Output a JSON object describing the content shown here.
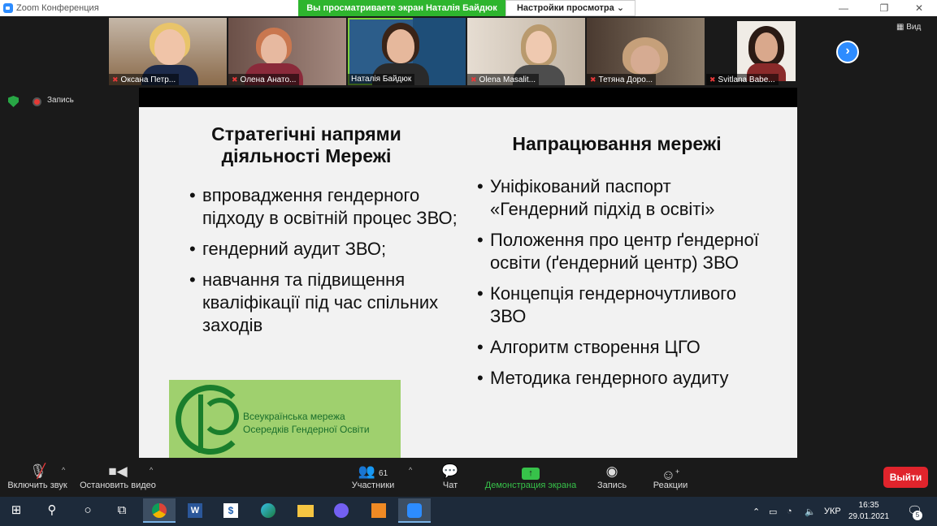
{
  "window": {
    "title": "Zoom Конференция"
  },
  "share_banner": "Вы просматриваете экран Наталія Байдюк",
  "view_options": "Настройки просмотра ⌄",
  "view_button": "Вид",
  "participants_strip": [
    {
      "name": "Оксана Петр...",
      "muted": true
    },
    {
      "name": "Олена Анато...",
      "muted": true
    },
    {
      "name": "Наталія Байдюк",
      "muted": false
    },
    {
      "name": "Olena Masalit...",
      "muted": true
    },
    {
      "name": "Тетяна Доро...",
      "muted": true
    },
    {
      "name": "Svitlana Babe...",
      "muted": true
    }
  ],
  "recording_label": "Запись",
  "slide": {
    "left_heading": "Стратегічні напрями діяльності Мережі",
    "left_heading_l1": "Стратегічні напрями",
    "left_heading_l2": "діяльності Мережі",
    "right_heading": "Напрацювання мережі",
    "left_items": [
      "впровадження гендерного підходу в освітній процес ЗВО;",
      "гендерний аудит ЗВО;",
      "навчання та підвищення кваліфікації під час спільних заходів"
    ],
    "right_items": [
      "Уніфікований паспорт «Гендерний підхід в освіті»",
      "Положення про центр ґендерної освіти (ґендерний центр) ЗВО",
      "Концепція гендерночутливого ЗВО",
      "Алгоритм створення ЦГО",
      "Методика гендерного аудиту"
    ],
    "logo_line1": "Всеукраїнська мережа",
    "logo_line2": "Осередків Гендерної Освіти"
  },
  "toolbar": {
    "unmute": "Включить звук",
    "stop_video": "Остановить видео",
    "participants": "Участники",
    "participants_count": "61",
    "chat": "Чат",
    "share_screen": "Демонстрация экрана",
    "record": "Запись",
    "reactions": "Реакции",
    "leave": "Выйти"
  },
  "taskbar": {
    "language": "УКР",
    "time": "16:35",
    "date": "29.01.2021",
    "notifications": "5"
  },
  "colors": {
    "share_green": "#2eb52e",
    "zoom_blue": "#2d8cff",
    "leave_red": "#e0242c"
  }
}
